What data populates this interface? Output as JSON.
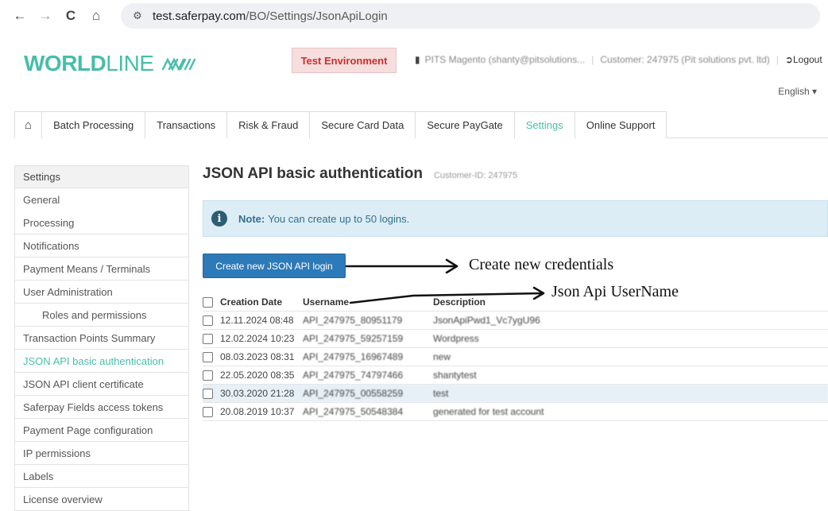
{
  "browser": {
    "back": "←",
    "forward": "→",
    "reload": "C",
    "home": "⌂",
    "url_domain": "test.saferpay.com",
    "url_path": "/BO/Settings/JsonApiLogin"
  },
  "header": {
    "logo_bold": "WORLD",
    "logo_thin": "LINE",
    "environment": "Test Environment",
    "user": "PITS Magento (shanty@pitsolutions...",
    "customer": "Customer: 247975 (Pit solutions pvt. ltd)",
    "logout": "Logout",
    "language": "English"
  },
  "tabs": [
    {
      "label": "Batch Processing"
    },
    {
      "label": "Transactions"
    },
    {
      "label": "Risk & Fraud"
    },
    {
      "label": "Secure Card Data"
    },
    {
      "label": "Secure PayGate"
    },
    {
      "label": "Settings"
    },
    {
      "label": "Online Support"
    }
  ],
  "sidebar": {
    "heading": "Settings",
    "items": [
      {
        "label": "General"
      },
      {
        "label": "Processing"
      },
      {
        "label": "Notifications"
      },
      {
        "label": "Payment Means / Terminals"
      },
      {
        "label": "User Administration"
      },
      {
        "label": "Roles and permissions"
      },
      {
        "label": "Transaction Points Summary"
      },
      {
        "label": "JSON API basic authentication"
      },
      {
        "label": "JSON API client certificate"
      },
      {
        "label": "Saferpay Fields access tokens"
      },
      {
        "label": "Payment Page configuration"
      },
      {
        "label": "IP permissions"
      },
      {
        "label": "Labels"
      },
      {
        "label": "License overview"
      }
    ]
  },
  "main": {
    "title": "JSON API basic authentication",
    "customer_id": "Customer-ID: 247975",
    "note_label": "Note:",
    "note_text": "You can create up to 50 logins.",
    "create_button": "Create new JSON API login",
    "columns": [
      "Creation Date",
      "Username",
      "Description"
    ],
    "rows": [
      {
        "date": "12.11.2024 08:48",
        "username": "API_247975_80951179",
        "description": "JsonApiPwd1_Vc7ygU96"
      },
      {
        "date": "12.02.2024 10:23",
        "username": "API_247975_59257159",
        "description": "Wordpress"
      },
      {
        "date": "08.03.2023 08:31",
        "username": "API_247975_16967489",
        "description": "new"
      },
      {
        "date": "22.05.2020 08:35",
        "username": "API_247975_74797466",
        "description": "shantytest"
      },
      {
        "date": "30.03.2020 21:28",
        "username": "API_247975_00558259",
        "description": "test"
      },
      {
        "date": "20.08.2019 10:37",
        "username": "API_247975_50548384",
        "description": "generated for test account"
      }
    ]
  },
  "annotations": {
    "create": "Create new credentials",
    "username": "Json Api UserName"
  }
}
